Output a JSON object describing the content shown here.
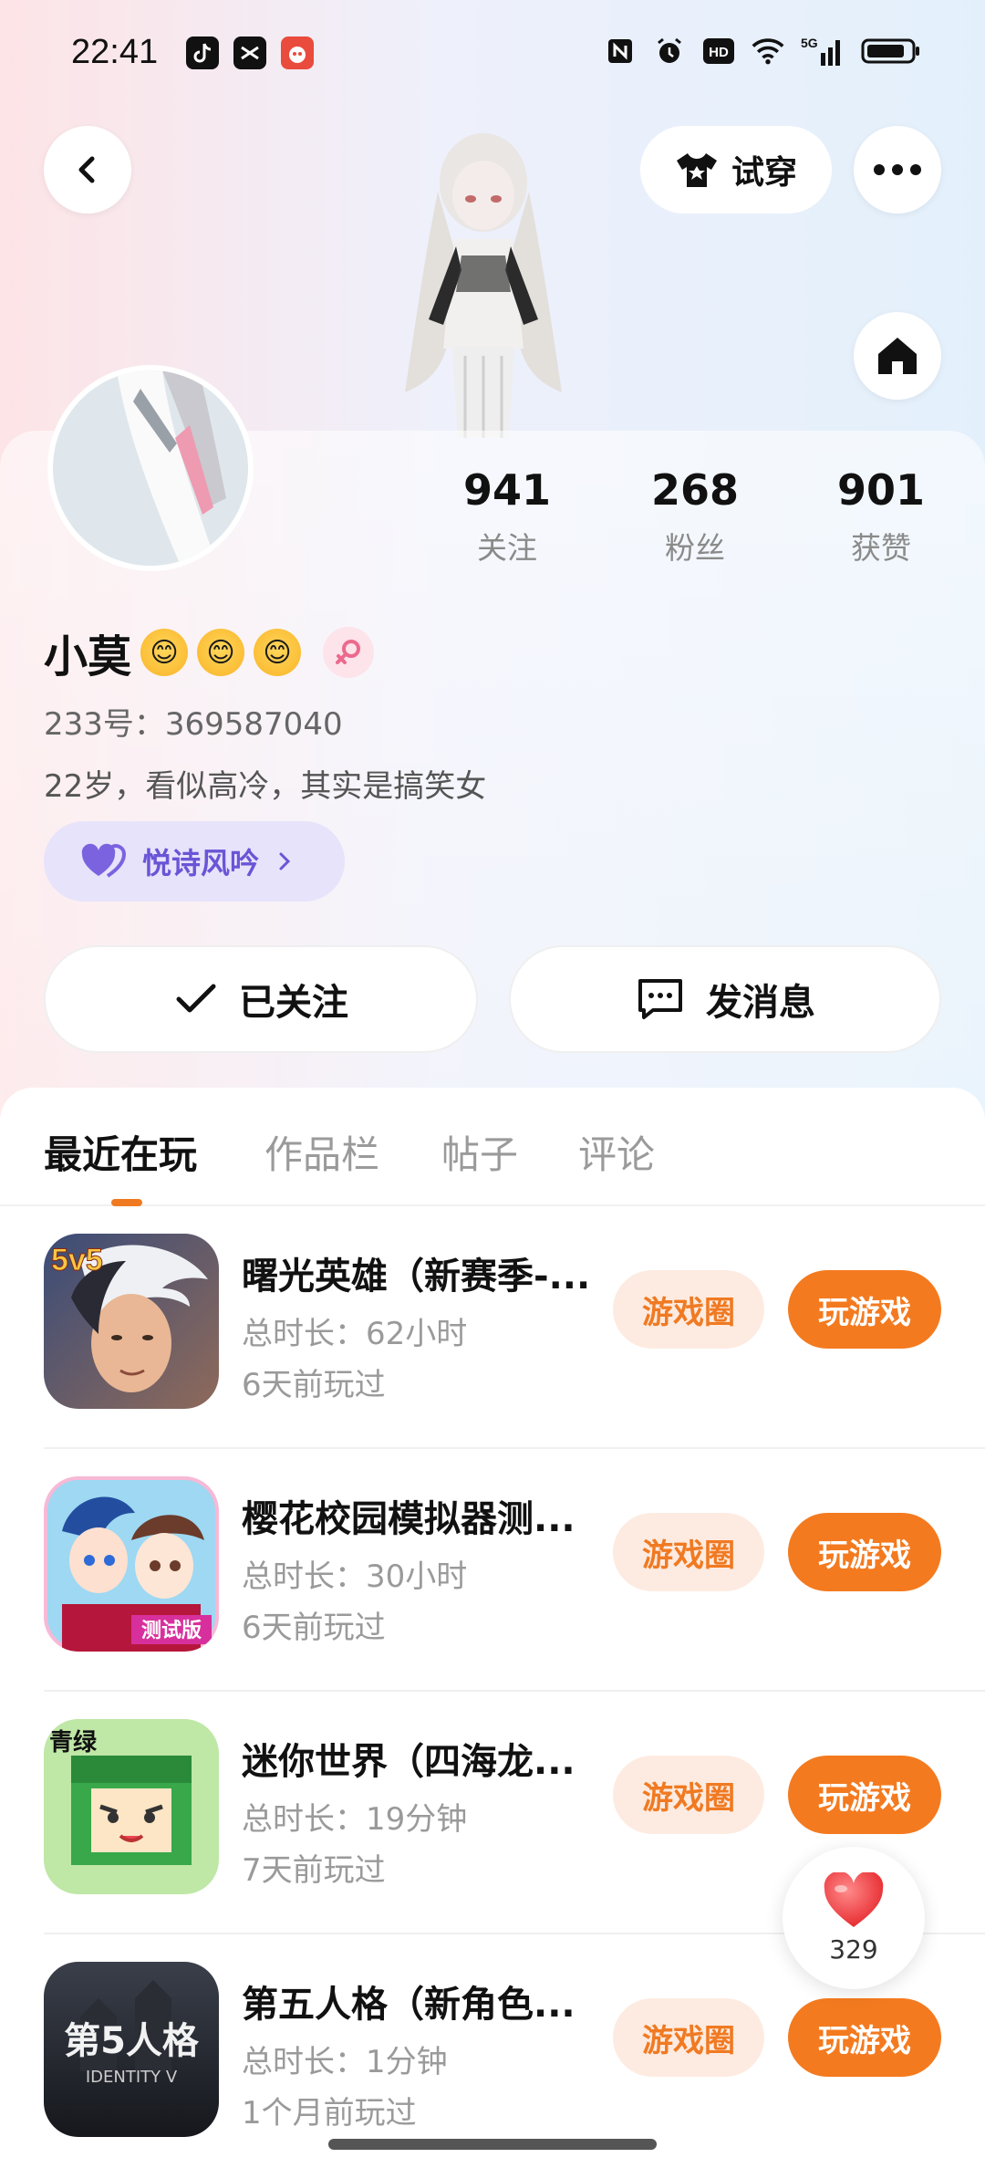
{
  "status_bar": {
    "time": "22:41",
    "network": "5G",
    "hd_label": "HD",
    "icons": [
      "tiktok-icon",
      "capcut-icon",
      "app-icon",
      "nfc-icon",
      "alarm-icon",
      "hd-icon",
      "wifi-icon",
      "signal-icon",
      "battery-icon"
    ]
  },
  "header": {
    "try_on_label": "试穿"
  },
  "profile": {
    "name": "小莫",
    "emojis": [
      "😊",
      "😊",
      "😊"
    ],
    "id_line": "233号：369587040",
    "bio": "22岁，看似高冷，其实是搞笑女",
    "tag": "悦诗风吟",
    "stats": [
      {
        "value": "941",
        "label": "关注"
      },
      {
        "value": "268",
        "label": "粉丝"
      },
      {
        "value": "901",
        "label": "获赞"
      }
    ],
    "follow_label": "已关注",
    "message_label": "发消息"
  },
  "tabs": [
    {
      "label": "最近在玩"
    },
    {
      "label": "作品栏"
    },
    {
      "label": "帖子"
    },
    {
      "label": "评论"
    }
  ],
  "games": [
    {
      "title": "曙光英雄（新赛季-...",
      "duration": "总时长：62小时",
      "last_played": "6天前玩过",
      "circle_label": "游戏圈",
      "play_label": "玩游戏",
      "badge": "5v5"
    },
    {
      "title": "樱花校园模拟器测...",
      "duration": "总时长：30小时",
      "last_played": "6天前玩过",
      "circle_label": "游戏圈",
      "play_label": "玩游戏",
      "badge": "测试版"
    },
    {
      "title": "迷你世界（四海龙...",
      "duration": "总时长：19分钟",
      "last_played": "7天前玩过",
      "circle_label": "游戏圈",
      "play_label": "玩游戏",
      "badge": "青绿"
    },
    {
      "title": "第五人格（新角色...",
      "duration": "总时长：1分钟",
      "last_played": "1个月前玩过",
      "circle_label": "游戏圈",
      "play_label": "玩游戏",
      "badge": "第5人格",
      "badge_sub": "IDENTITY V"
    }
  ],
  "like_float": {
    "count": "329"
  },
  "colors": {
    "accent": "#f47a1f",
    "accent_soft": "#fdebe1",
    "tag_bg": "#e7e3fb",
    "tag_text": "#6a55d6"
  }
}
